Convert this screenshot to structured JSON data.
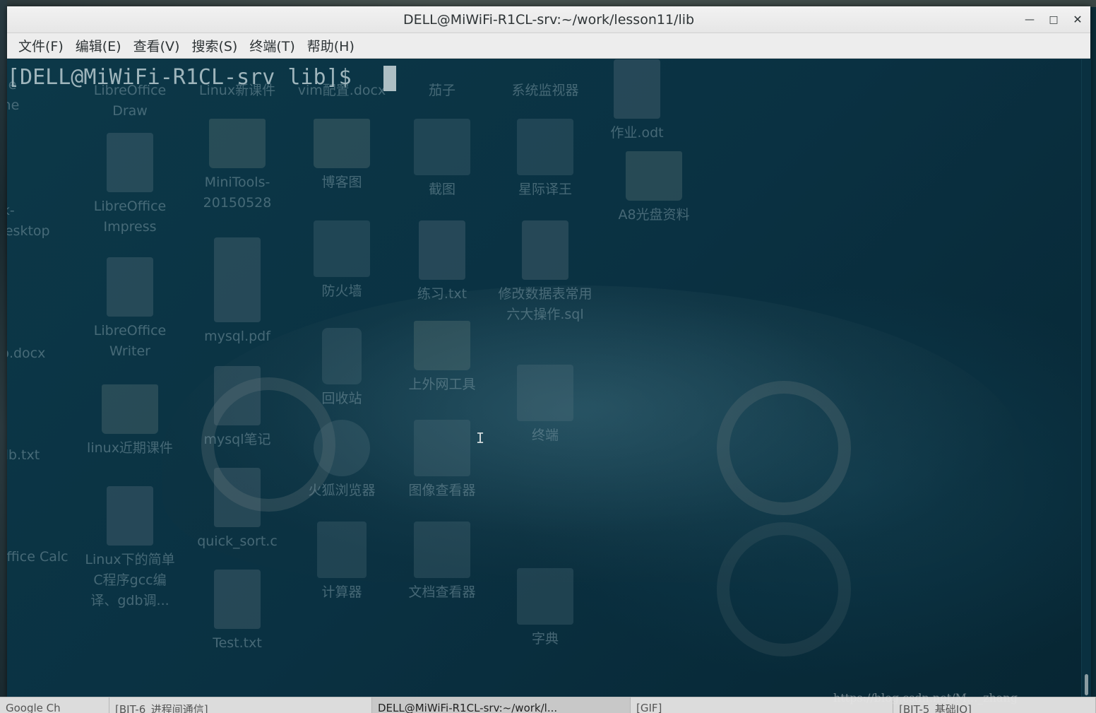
{
  "window": {
    "title": "DELL@MiWiFi-R1CL-srv:~/work/lesson11/lib",
    "minimize_icon": "minimize-icon",
    "maximize_icon": "maximize-icon",
    "close_icon": "close-icon"
  },
  "menubar": {
    "items": [
      "文件(F)",
      "编辑(E)",
      "查看(V)",
      "搜索(S)",
      "终端(T)",
      "帮助(H)"
    ]
  },
  "terminal": {
    "prompt": "[DELL@MiWiFi-R1CL-srv lib]$ "
  },
  "desktop_icons": [
    {
      "label": "LibreOffice Draw"
    },
    {
      "label": "Linux新课件"
    },
    {
      "label": "vim配置.docx"
    },
    {
      "label": "茄子"
    },
    {
      "label": "系统监视器"
    },
    {
      "label": "作业.odt"
    },
    {
      "label": "LibreOffice Impress"
    },
    {
      "label": "MiniTools-20150528"
    },
    {
      "label": "博客图"
    },
    {
      "label": "截图"
    },
    {
      "label": "星际译王"
    },
    {
      "label": "A8光盘资料"
    },
    {
      "label": "LibreOffice Writer"
    },
    {
      "label": "mysql.pdf"
    },
    {
      "label": "防火墙"
    },
    {
      "label": "练习.txt"
    },
    {
      "label": "修改数据表常用六大操作.sql"
    },
    {
      "label": "回收站"
    },
    {
      "label": "上外网工具"
    },
    {
      "label": "终端"
    },
    {
      "label": "linux近期课件"
    },
    {
      "label": "mysql笔记"
    },
    {
      "label": "火狐浏览器"
    },
    {
      "label": "图像查看器"
    },
    {
      "label": "Linux下的简单C程序gcc编译、gdb调..."
    },
    {
      "label": "quick_sort.c"
    },
    {
      "label": "计算器"
    },
    {
      "label": "文档查看器"
    },
    {
      "label": "Test.txt"
    },
    {
      "label": "字典"
    }
  ],
  "left_edge_labels": [
    "Google Chrome",
    "gtk-ordMyDesktop",
    "lb.docx",
    "db.txt",
    "reOffice Calc"
  ],
  "taskbar": {
    "items": [
      {
        "label": "Google Ch"
      },
      {
        "label": "[BIT-6_进程间通信]"
      },
      {
        "label": "DELL@MiWiFi-R1CL-srv:~/work/l..."
      },
      {
        "label": "[GIF]"
      },
      {
        "label": "[BIT-5_基础IO]"
      }
    ]
  },
  "watermark": "https://blog.csdn.net/M..._zhang"
}
